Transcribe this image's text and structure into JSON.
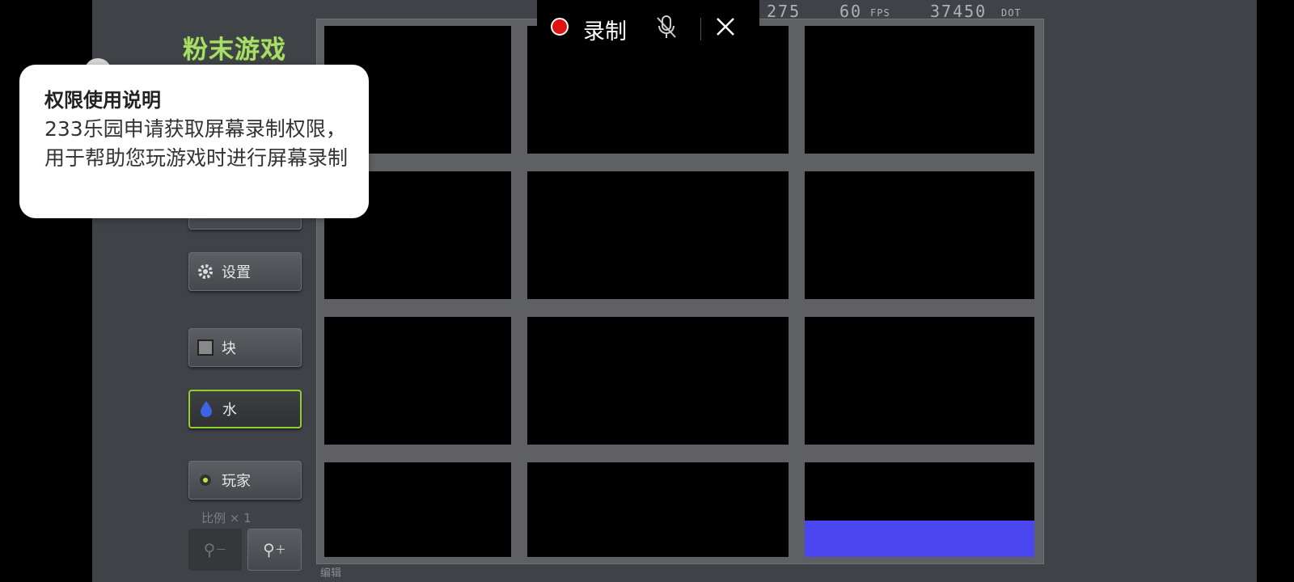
{
  "app": {
    "logo": "粉末游戏"
  },
  "sidebar": {
    "settings_label": "设置",
    "block_label": "块",
    "water_label": "水",
    "player_label": "玩家",
    "scale_label": "比例 × 1",
    "zoom_out_label": "－",
    "zoom_in_label": "＋",
    "selected": "水"
  },
  "canvas": {
    "edit_label": "编辑"
  },
  "hud": {
    "dots_count": "275",
    "fps_value": "60",
    "fps_unit": "FPS",
    "dot_value": "37450",
    "dot_unit": "DOT"
  },
  "recorder": {
    "label": "录制"
  },
  "permission": {
    "title": "权限使用说明",
    "body": "233乐园申请获取屏幕录制权限，用于帮助您玩游戏时进行屏幕录制"
  },
  "colors": {
    "background": "#3f4247",
    "logo": "#a9dd6b",
    "water_fill": "#4a46f0",
    "selected_border": "#8fd12f",
    "record_dot": "#e01313"
  }
}
